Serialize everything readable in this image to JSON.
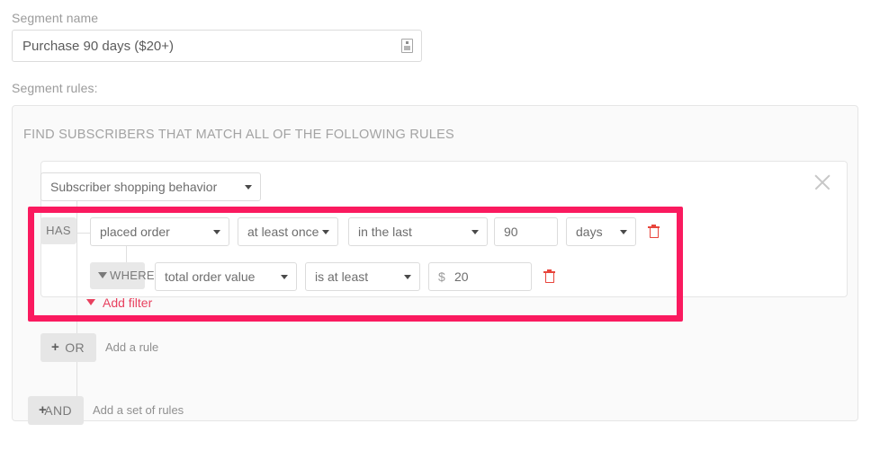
{
  "segment": {
    "name_label": "Segment name",
    "name_value": "Purchase 90 days ($20+)",
    "name_placeholder": "Segment name",
    "name_icon": "text-resize-icon",
    "rules_label": "Segment rules:"
  },
  "rules_panel": {
    "heading": "FIND SUBSCRIBERS THAT MATCH ALL OF THE FOLLOWING RULES",
    "close_icon": "close-icon"
  },
  "rule_group": {
    "behavior_select": {
      "value": "Subscriber shopping behavior",
      "caret_icon": "chevron-down-icon"
    },
    "rule_row": {
      "connector_label": "HAS",
      "action_select": "placed order",
      "frequency_select": "at least once",
      "period_select": "in the last",
      "number_value": "90",
      "number_placeholder": "",
      "unit_select": "days",
      "delete_icon": "trash-icon"
    },
    "filter_row": {
      "where_label": "WHERE",
      "where_icon": "funnel-icon",
      "field_select": "total order value",
      "operator_select": "is at least",
      "currency_symbol": "$",
      "value": "20",
      "value_placeholder": "",
      "delete_icon": "trash-icon"
    },
    "add_filter": {
      "label": "Add filter",
      "icon": "funnel-icon"
    },
    "or_row": {
      "plus": "+",
      "label": "OR",
      "hint": "Add a rule"
    }
  },
  "and_row": {
    "plus": "+",
    "label": "AND",
    "hint": "Add a set of rules"
  },
  "colors": {
    "highlight": "#fa1a5f",
    "accent_link": "#e8415f",
    "delete": "#e8453c",
    "panel_bg": "#fafafa",
    "border": "#e6e6e6",
    "text_muted": "#9b9b9b"
  }
}
